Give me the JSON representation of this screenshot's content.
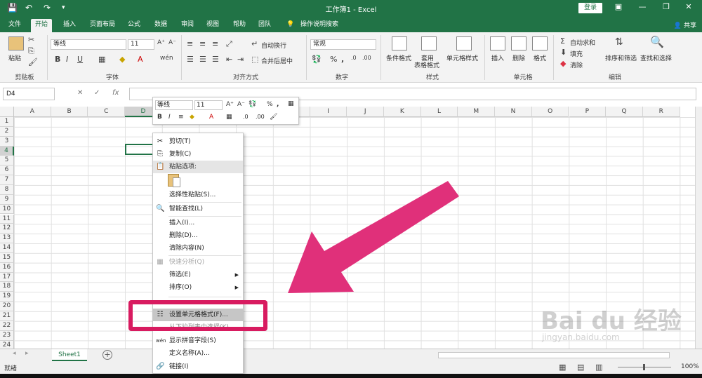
{
  "window": {
    "title": "工作簿1 - Excel",
    "login": "登录",
    "share": "共享"
  },
  "tabs": [
    "文件",
    "开始",
    "插入",
    "页面布局",
    "公式",
    "数据",
    "审阅",
    "视图",
    "帮助",
    "团队",
    "操作说明搜索"
  ],
  "ribbon": {
    "clipboard": {
      "label": "剪贴板",
      "paste": "粘贴"
    },
    "font": {
      "label": "字体",
      "name": "等线",
      "size": "11"
    },
    "alignment": {
      "label": "对齐方式",
      "wrap": "自动换行",
      "merge": "合并后居中"
    },
    "number": {
      "label": "数字",
      "format": "常规"
    },
    "styles": {
      "label": "样式",
      "conditional": "条件格式",
      "table": "套用\n表格格式",
      "cell": "单元格样式"
    },
    "cells": {
      "label": "单元格",
      "insert": "插入",
      "delete": "删除",
      "format": "格式"
    },
    "editing": {
      "label": "编辑",
      "autosum": "自动求和",
      "fill": "填充",
      "clear": "清除",
      "sort": "排序和筛选",
      "find": "查找和选择"
    }
  },
  "formula_bar": {
    "namebox": "D4",
    "fx": "fx"
  },
  "columns": [
    "A",
    "B",
    "C",
    "D",
    "E",
    "F",
    "G",
    "H",
    "I",
    "J",
    "K",
    "L",
    "M",
    "N",
    "O",
    "P",
    "Q",
    "R"
  ],
  "rows": [
    "1",
    "2",
    "3",
    "4",
    "5",
    "6",
    "7",
    "8",
    "9",
    "10",
    "11",
    "12",
    "13",
    "14",
    "15",
    "16",
    "17",
    "18",
    "19",
    "20",
    "21",
    "22",
    "23",
    "24"
  ],
  "mini_toolbar": {
    "font": "等线",
    "size": "11"
  },
  "context_menu": [
    {
      "label": "剪切(T)",
      "icon": "✂"
    },
    {
      "label": "复制(C)",
      "icon": "⎘"
    },
    {
      "label": "粘贴选项:",
      "icon": "📋"
    },
    {
      "label": "选择性粘贴(S)...",
      "icon": ""
    },
    {
      "label": "智能查找(L)",
      "icon": "🔍"
    },
    {
      "label": "插入(I)...",
      "icon": ""
    },
    {
      "label": "删除(D)...",
      "icon": ""
    },
    {
      "label": "清除内容(N)",
      "icon": ""
    },
    {
      "label": "快速分析(Q)",
      "icon": "▦"
    },
    {
      "label": "筛选(E)",
      "icon": ""
    },
    {
      "label": "排序(O)",
      "icon": ""
    },
    {
      "label": "设置单元格格式(F)...",
      "icon": "☷"
    },
    {
      "label": "从下拉列表中选择(K)...",
      "icon": ""
    },
    {
      "label": "显示拼音字段(S)",
      "icon": "wén"
    },
    {
      "label": "定义名称(A)...",
      "icon": ""
    },
    {
      "label": "链接(I)",
      "icon": "🔗"
    }
  ],
  "sheets": [
    "Sheet1"
  ],
  "status": {
    "ready": "就绪",
    "zoom": "100%"
  },
  "watermark": {
    "main": "Bai du 经验",
    "sub": "jingyan.baidu.com"
  },
  "colors": {
    "excel_green": "#217346",
    "annotation_pink": "#d81b60"
  }
}
